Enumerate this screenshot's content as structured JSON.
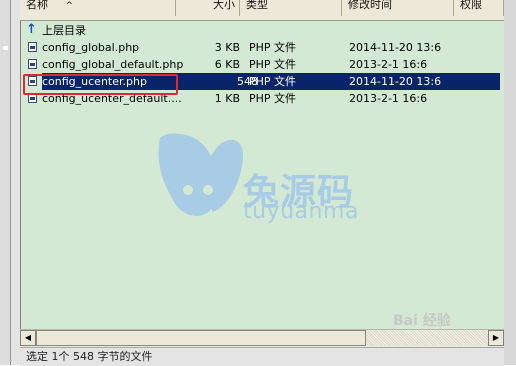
{
  "columns": {
    "name": "名称",
    "size": "大小",
    "type": "类型",
    "modified": "修改时间",
    "perms": "权限"
  },
  "parent_label": "上层目录",
  "files": [
    {
      "name": "config_global.php",
      "size": "3 KB",
      "type": "PHP 文件",
      "date": "2014-11-20 13:6"
    },
    {
      "name": "config_global_default.php",
      "size": "6 KB",
      "type": "PHP 文件",
      "date": "2013-2-1 16:6"
    },
    {
      "name": "config_ucenter.php",
      "size": "548",
      "type": "PHP 文件",
      "date": "2014-11-20 13:6"
    },
    {
      "name": "config_ucenter_default....",
      "size": "1 KB",
      "type": "PHP 文件",
      "date": "2013-2-1 16:6"
    }
  ],
  "selected_index": 2,
  "watermark": {
    "title": "兔源码",
    "subtitle": "tuyuanma"
  },
  "status": "选定 1个 548 字节的文件",
  "corner_watermark": "Bai 经验",
  "colors": {
    "panel": "#d3e9d3",
    "selection": "#0a246a",
    "highlight": "#e0282e"
  }
}
